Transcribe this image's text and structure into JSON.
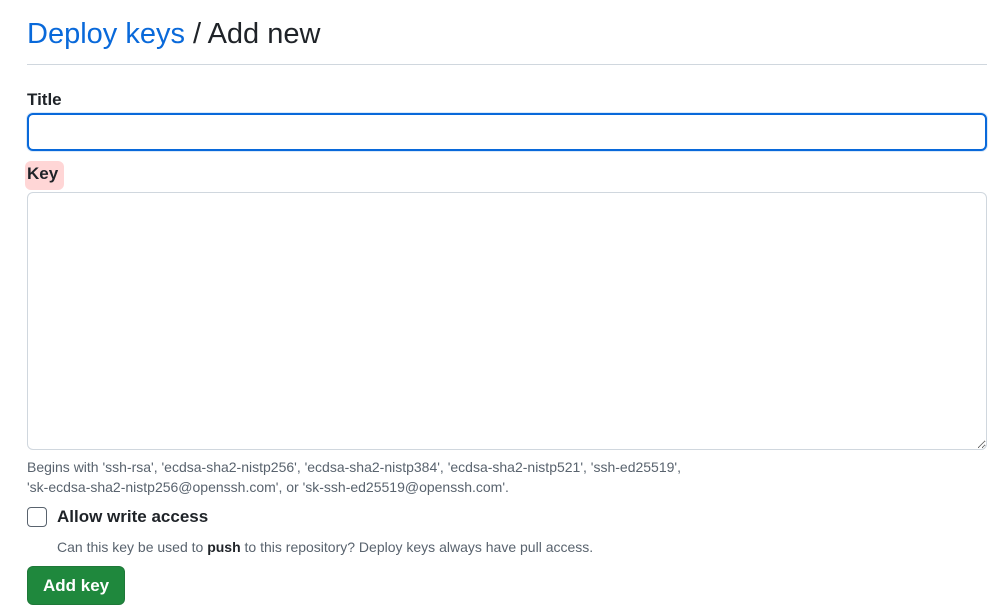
{
  "heading": {
    "link_text": "Deploy keys",
    "separator": "/",
    "current": "Add new"
  },
  "form": {
    "title_label": "Title",
    "title_value": "",
    "key_label": "Key",
    "key_value": "",
    "key_help_line1": "Begins with 'ssh-rsa', 'ecdsa-sha2-nistp256', 'ecdsa-sha2-nistp384', 'ecdsa-sha2-nistp521', 'ssh-ed25519',",
    "key_help_line2": "'sk-ecdsa-sha2-nistp256@openssh.com', or 'sk-ssh-ed25519@openssh.com'.",
    "allow_write_label": "Allow write access",
    "allow_write_checked": false,
    "allow_write_note_before": "Can this key be used to ",
    "allow_write_note_bold": "push",
    "allow_write_note_after": " to this repository? Deploy keys always have pull access.",
    "submit_label": "Add key"
  },
  "colors": {
    "link": "#0969da",
    "primary_button": "#1f883d",
    "focus_border": "#0969da",
    "highlight": "#ff6b6b"
  }
}
